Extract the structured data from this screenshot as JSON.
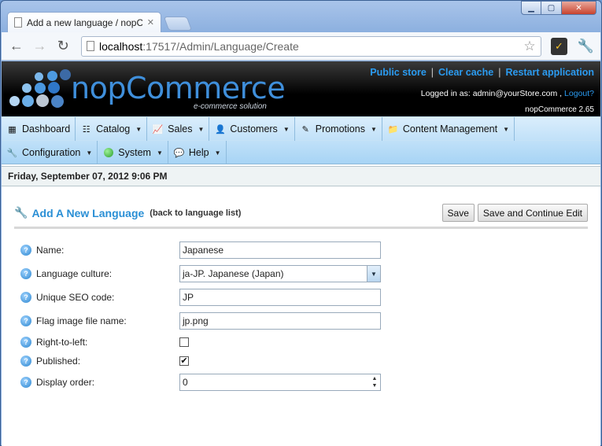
{
  "browser": {
    "tab_title": "Add a new language / nopC",
    "url_host": "localhost",
    "url_rest": ":17517/Admin/Language/Create"
  },
  "header": {
    "logo_text": "nopCommerce",
    "logo_tagline": "e-commerce solution",
    "links": {
      "public_store": "Public store",
      "clear_cache": "Clear cache",
      "restart": "Restart application"
    },
    "logged_in_prefix": "Logged in as: admin@yourStore.com ,",
    "logout": "Logout?",
    "version": "nopCommerce 2.65"
  },
  "menu": {
    "dashboard": "Dashboard",
    "catalog": "Catalog",
    "sales": "Sales",
    "customers": "Customers",
    "promotions": "Promotions",
    "content": "Content Management",
    "configuration": "Configuration",
    "system": "System",
    "help": "Help"
  },
  "date_text": "Friday, September 07, 2012 9:06 PM",
  "page": {
    "title": "Add A New Language",
    "back_link": "(back to language list)",
    "save": "Save",
    "save_continue": "Save and Continue Edit"
  },
  "form": {
    "name_label": "Name:",
    "name_value": "Japanese",
    "culture_label": "Language culture:",
    "culture_value": "ja-JP. Japanese (Japan)",
    "seo_label": "Unique SEO code:",
    "seo_value": "JP",
    "flag_label": "Flag image file name:",
    "flag_value": "jp.png",
    "rtl_label": "Right-to-left:",
    "published_label": "Published:",
    "order_label": "Display order:",
    "order_value": "0",
    "rtl_checked": false,
    "published_checked": true
  },
  "colors": {
    "accent": "#2a8fd5",
    "header_link": "#2b9bf0"
  }
}
